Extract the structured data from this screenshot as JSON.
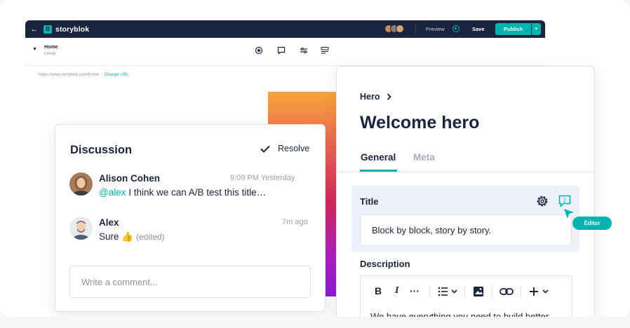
{
  "app": {
    "brand": "storyblok",
    "topbar": {
      "preview_label": "Preview",
      "save_label": "Save",
      "publish_label": "Publish"
    },
    "page": {
      "name": "Home",
      "slug": "home"
    },
    "url": {
      "value": "https://www.storyblok.com/home",
      "change_label": "Change URL"
    }
  },
  "discussion": {
    "title": "Discussion",
    "resolve_label": "Resolve",
    "comments": [
      {
        "author": "Alison Cohen",
        "time": "9:09 PM Yesterday",
        "mention": "@alex",
        "text": " I think we can A/B test this title…"
      },
      {
        "author": "Alex",
        "time": "7m ago",
        "text": "Sure 👍",
        "edited": "(edited)"
      }
    ],
    "input_placeholder": "Write a comment..."
  },
  "panel": {
    "breadcrumb": "Hero",
    "title": "Welcome hero",
    "tabs": [
      {
        "label": "General"
      },
      {
        "label": "Meta"
      }
    ],
    "title_field": {
      "label": "Title",
      "value": "Block by block, story by story.",
      "comment_count": "2"
    },
    "description_field": {
      "label": "Description",
      "text": "We have everything you need to build better"
    }
  },
  "cursor": {
    "tag": "Editor"
  },
  "colors": {
    "accent": "#00b3b0",
    "navy": "#1b243f",
    "field_bg": "#eef0fb"
  }
}
